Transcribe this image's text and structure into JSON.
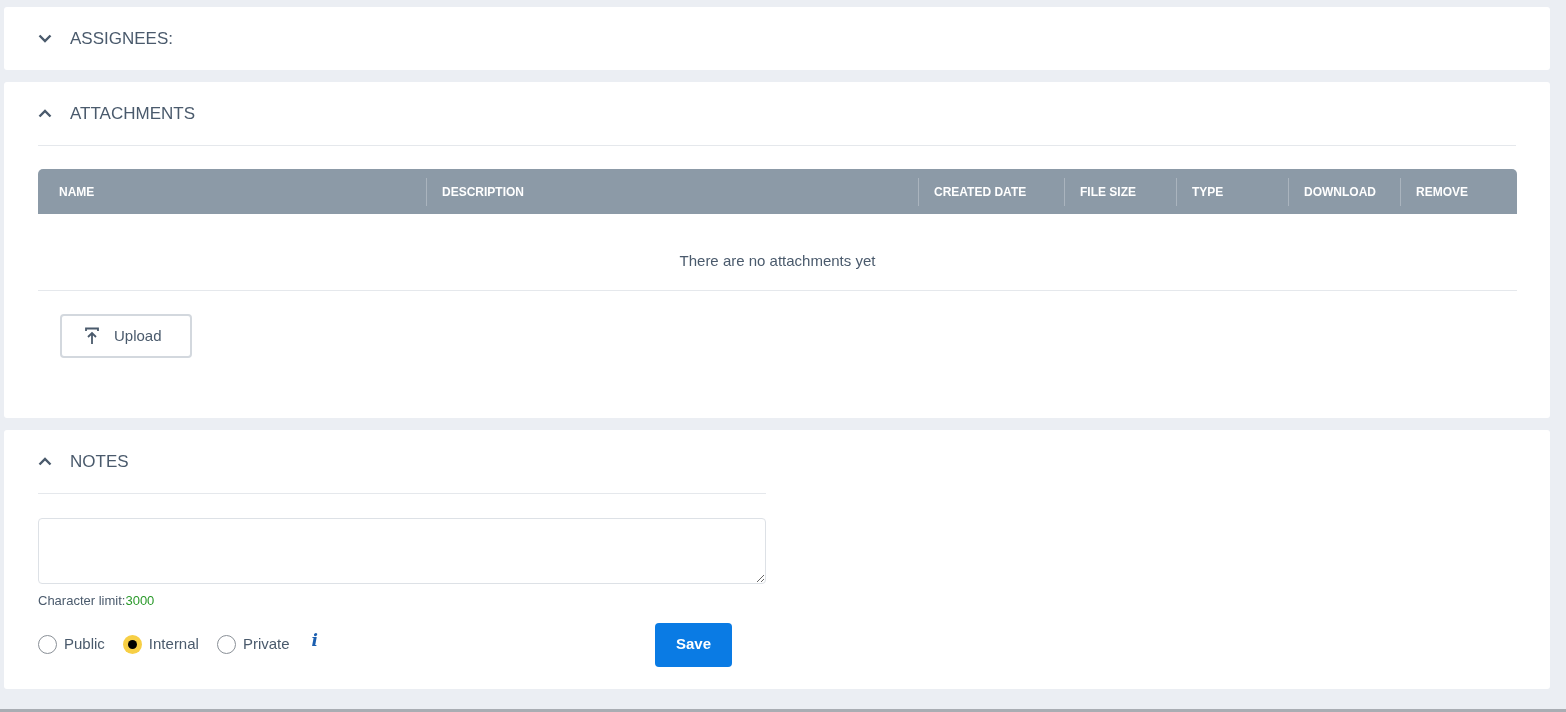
{
  "sections": [
    {
      "title": "ASSIGNEES:",
      "expanded": false
    },
    {
      "kind": "attachments",
      "title": "ATTACHMENTS",
      "expanded": true,
      "table": {
        "columns": [
          "NAME",
          "DESCRIPTION",
          "CREATED DATE",
          "FILE SIZE",
          "TYPE",
          "DOWNLOAD",
          "REMOVE"
        ],
        "empty_message": "There are no attachments yet"
      },
      "upload_button": "Upload"
    },
    {
      "kind": "notes",
      "title": "NOTES",
      "expanded": true,
      "character_limit_label": "Character limit:",
      "character_limit_value": "3000",
      "visibility": [
        {
          "label": "Public",
          "selected": false
        },
        {
          "label": "Internal",
          "selected": true
        },
        {
          "label": "Private",
          "selected": false
        }
      ],
      "info_icon": "i",
      "save_button": "Save"
    }
  ]
}
